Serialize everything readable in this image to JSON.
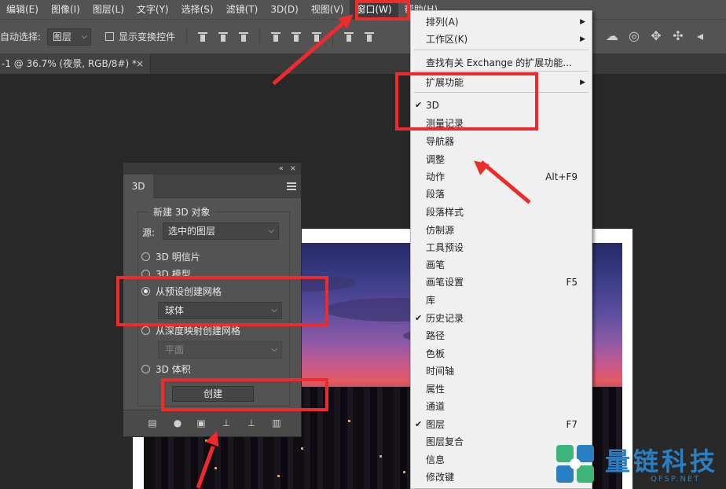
{
  "menubar": {
    "items": [
      "编辑(E)",
      "图像(I)",
      "图层(L)",
      "文字(Y)",
      "选择(S)",
      "滤镜(T)",
      "3D(D)",
      "视图(V)",
      "窗口(W)",
      "帮助(H)"
    ]
  },
  "optbar": {
    "auto_select_label": "自动选择:",
    "auto_select_value": "图层",
    "show_transform_label": "显示变换控件"
  },
  "document_tab": {
    "label": "-1 @ 36.7% (夜景, RGB/8#) *",
    "close": "×"
  },
  "panel_3d": {
    "tab_label": "3D",
    "group_title": "新建 3D 对象",
    "source_label": "源:",
    "source_value": "选中的图层",
    "options": {
      "postcard": "3D 明信片",
      "model": "3D 模型",
      "mesh_from_preset": "从预设创建网格",
      "mesh_from_depth": "从深度映射创建网格",
      "volume": "3D 体积"
    },
    "mesh_preset_value": "球体",
    "depth_map_value": "平面",
    "create_button": "创建",
    "collapse": "«",
    "close": "×"
  },
  "window_menu": {
    "items": [
      {
        "label": "排列(A)",
        "submenu": true
      },
      {
        "label": "工作区(K)",
        "submenu": true
      },
      {
        "label": "查找有关 Exchange 的扩展功能..."
      },
      {
        "label": "扩展功能",
        "submenu": true
      },
      {
        "label": "3D",
        "checked": true
      },
      {
        "label": "测量记录"
      },
      {
        "label": "导航器"
      },
      {
        "label": "调整"
      },
      {
        "label": "动作",
        "shortcut": "Alt+F9"
      },
      {
        "label": "段落"
      },
      {
        "label": "段落样式"
      },
      {
        "label": "仿制源"
      },
      {
        "label": "工具预设"
      },
      {
        "label": "画笔"
      },
      {
        "label": "画笔设置",
        "shortcut": "F5"
      },
      {
        "label": "库"
      },
      {
        "label": "历史记录",
        "checked": true
      },
      {
        "label": "路径"
      },
      {
        "label": "色板"
      },
      {
        "label": "时间轴"
      },
      {
        "label": "属性"
      },
      {
        "label": "通道"
      },
      {
        "label": "图层",
        "checked": true,
        "shortcut": "F7"
      },
      {
        "label": "图层复合"
      },
      {
        "label": "信息"
      },
      {
        "label": "修改键"
      }
    ],
    "check_mark": "✔",
    "submenu_arrow": "▶"
  },
  "watermark": {
    "name": "量链科技",
    "site": "QFSP.NET"
  },
  "colors": {
    "annotation": "#ee2b2b",
    "watermark": "#2a7fc2"
  }
}
